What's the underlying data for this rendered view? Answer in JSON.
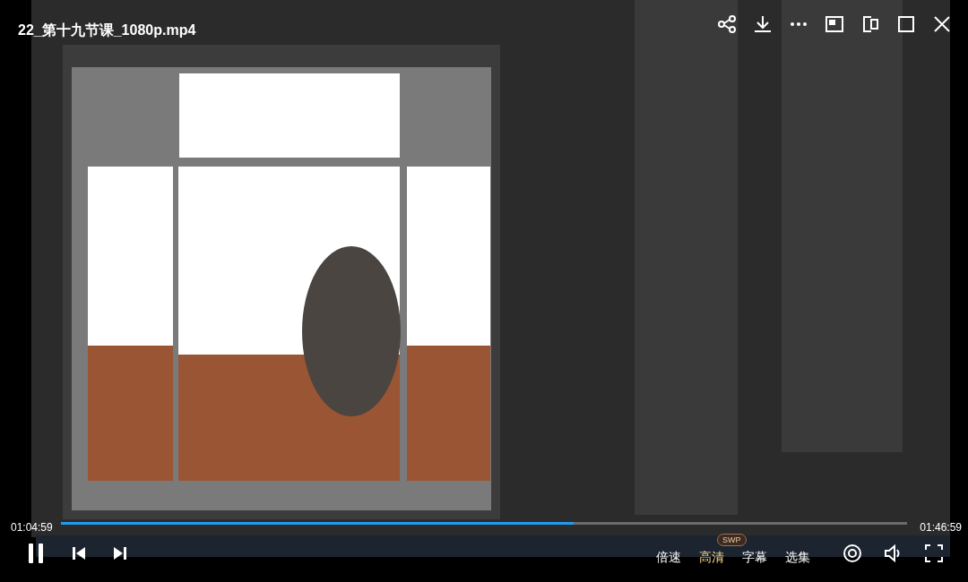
{
  "video": {
    "title": "22_第十九节课_1080p.mp4"
  },
  "progress": {
    "elapsed": "01:04:59",
    "duration": "01:46:59",
    "level": 0.606
  },
  "options": [
    {
      "label": "倍速",
      "highlighted": false
    },
    {
      "label": "高清",
      "highlighted": true,
      "badge": "SWP"
    },
    {
      "label": "字幕",
      "highlighted": false
    },
    {
      "label": "选集",
      "highlighted": false
    }
  ],
  "playing": true
}
